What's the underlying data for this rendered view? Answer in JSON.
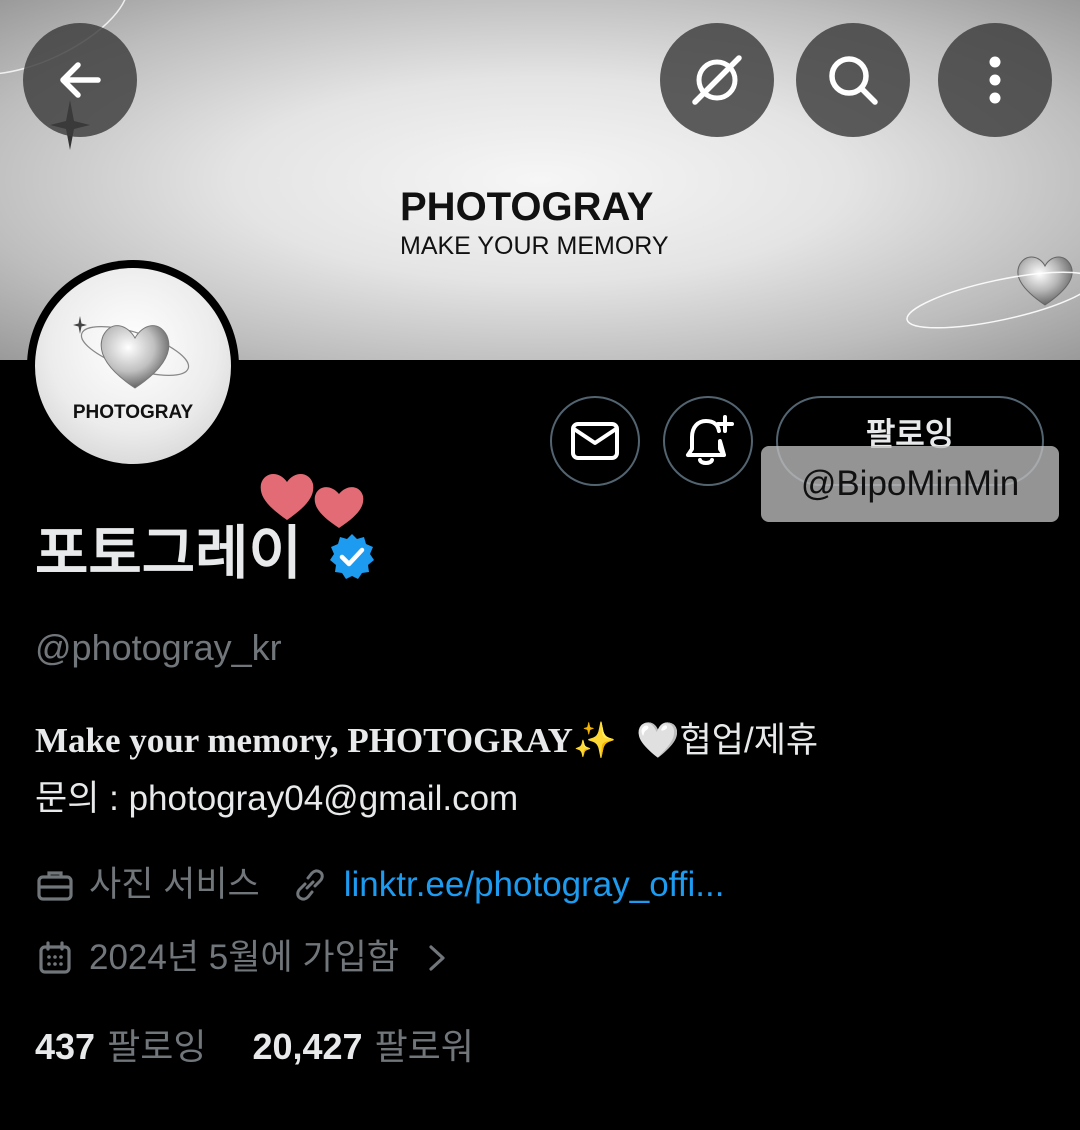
{
  "banner": {
    "brand_title": "PHOTOGRAY",
    "brand_subtitle": "MAKE YOUR MEMORY"
  },
  "toolbar": {
    "back_icon": "arrow-left-icon",
    "grok_icon": "slashed-circle-icon",
    "search_icon": "search-icon",
    "more_icon": "more-vertical-icon"
  },
  "avatar": {
    "label": "PHOTOGRAY"
  },
  "actions": {
    "message_icon": "mail-icon",
    "notify_icon": "bell-plus-icon",
    "follow_label": "팔로잉"
  },
  "watermark": "@BipoMinMin",
  "profile": {
    "display_name": "포토그레이",
    "handle": "@photogray_kr",
    "bio_line1_serif": "Make your memory, PHOTOGRAY",
    "bio_line1_emoji": "✨",
    "bio_line1_heart": "🤍",
    "bio_line1_rest": "협업/제휴",
    "bio_line2": "문의 : photogray04@gmail.com",
    "category": "사진 서비스",
    "link": "linktr.ee/photogray_offi...",
    "joined": "2024년 5월에 가입함",
    "following_count": "437",
    "following_label": "팔로잉",
    "followers_count": "20,427",
    "followers_label": "팔로워"
  },
  "colors": {
    "accent_link": "#1d9bf0",
    "verified_badge": "#1d9bf0",
    "secondary_text": "#71767b",
    "background": "#000000"
  }
}
